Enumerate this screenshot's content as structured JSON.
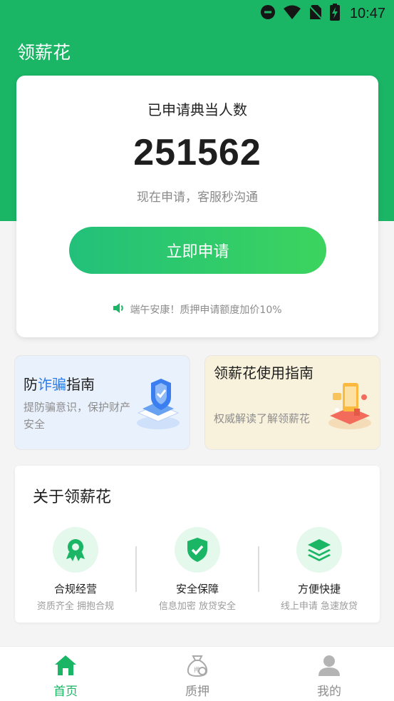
{
  "status_bar": {
    "time": "10:47"
  },
  "app": {
    "title": "领薪花"
  },
  "hero": {
    "label": "已申请典当人数",
    "count": "251562",
    "subtitle": "现在申请，客服秒沟通",
    "apply_button": "立即申请",
    "notice": "端午安康！质押申请额度加价10%"
  },
  "guides": {
    "fraud": {
      "title_prefix": "防",
      "title_highlight": "诈骗",
      "title_suffix": "指南",
      "desc": "提防骗意识，保护财产安全"
    },
    "usage": {
      "title": "领薪花使用指南",
      "desc": "权威解读了解领薪花"
    }
  },
  "about": {
    "title": "关于领薪花",
    "features": [
      {
        "label": "合规经营",
        "sub": "资质齐全 拥抱合规"
      },
      {
        "label": "安全保障",
        "sub": "信息加密 放贷安全"
      },
      {
        "label": "方便快捷",
        "sub": "线上申请 急速放贷"
      }
    ]
  },
  "tabs": [
    {
      "label": "首页",
      "active": true
    },
    {
      "label": "质押",
      "active": false
    },
    {
      "label": "我的",
      "active": false
    }
  ],
  "colors": {
    "brand_green": "#1bb566",
    "button_green": "#30c96b",
    "highlight_blue": "#2a7be6"
  }
}
